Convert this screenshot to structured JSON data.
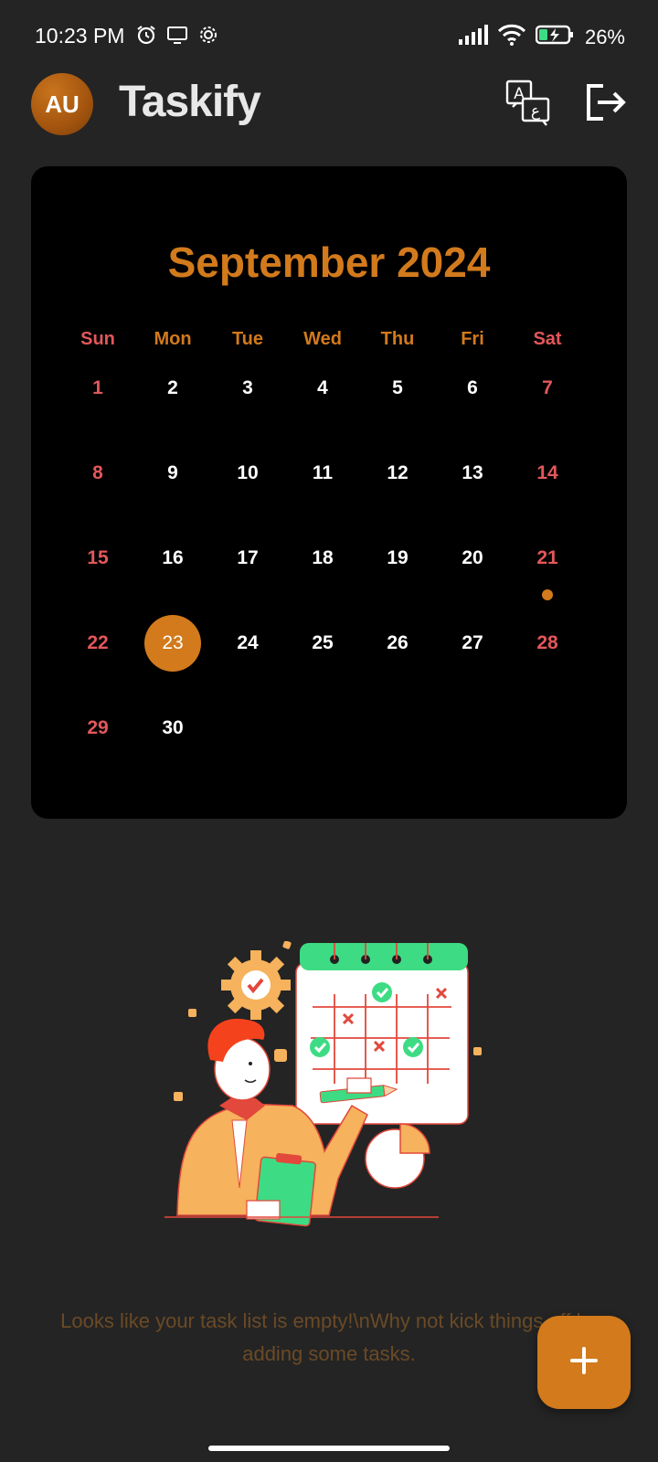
{
  "status_bar": {
    "time": "10:23 PM",
    "left_icons": [
      "alarm-icon",
      "screen-cast-icon",
      "settings-icon"
    ],
    "right_icons": [
      "signal-icon",
      "wifi-icon",
      "battery-charging-icon"
    ],
    "battery": "26%"
  },
  "header": {
    "avatar_initials": "AU",
    "title": "Taskify",
    "actions": [
      "translate-icon",
      "logout-icon"
    ]
  },
  "calendar": {
    "month_title": "September 2024",
    "weekdays": [
      "Sun",
      "Mon",
      "Tue",
      "Wed",
      "Thu",
      "Fri",
      "Sat"
    ],
    "weeks": [
      [
        "1",
        "2",
        "3",
        "4",
        "5",
        "6",
        "7"
      ],
      [
        "8",
        "9",
        "10",
        "11",
        "12",
        "13",
        "14"
      ],
      [
        "15",
        "16",
        "17",
        "18",
        "19",
        "20",
        "21"
      ],
      [
        "22",
        "23",
        "24",
        "25",
        "26",
        "27",
        "28"
      ],
      [
        "29",
        "30"
      ]
    ],
    "selected_day": "23",
    "event_days": [
      "21"
    ]
  },
  "empty_state": {
    "message": "Looks like your task list is empty!\\nWhy not kick things off by adding some tasks."
  },
  "fab": {
    "icon": "plus-icon"
  },
  "colors": {
    "accent": "#d27a1c",
    "weekend": "#e2575b",
    "background": "#242424",
    "calendar_bg": "#000000"
  }
}
